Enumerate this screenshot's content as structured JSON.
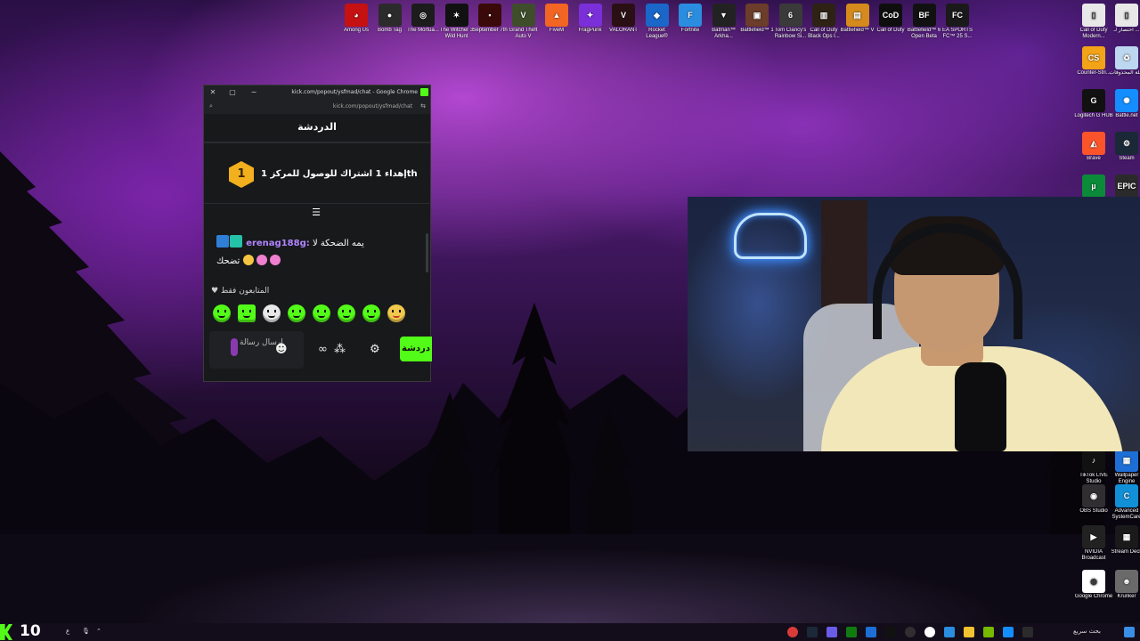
{
  "desktop": {
    "top_icons": [
      {
        "label": "Among Us",
        "color": "#c51111",
        "glyph": "◕"
      },
      {
        "label": "Bomb Tag",
        "color": "#2b2b2b",
        "glyph": "●"
      },
      {
        "label": "The Mortua...",
        "color": "#1c1c1c",
        "glyph": "◎"
      },
      {
        "label": "The Witcher 3 Wild Hunt",
        "color": "#111111",
        "glyph": "✶"
      },
      {
        "label": "September 7th",
        "color": "#3a0a0a",
        "glyph": "▪"
      },
      {
        "label": "Grand Theft Auto V",
        "color": "#3f4d2a",
        "glyph": "V"
      },
      {
        "label": "FiveM",
        "color": "#f26522",
        "glyph": "▲"
      },
      {
        "label": "FragPunk",
        "color": "#7a2fd8",
        "glyph": "✦"
      },
      {
        "label": "VALORANT",
        "color": "#2a1014",
        "glyph": "V"
      },
      {
        "label": "Rocket League®",
        "color": "#1b66c9",
        "glyph": "◆"
      },
      {
        "label": "Fortnite",
        "color": "#2a8de0",
        "glyph": "F"
      },
      {
        "label": "Batman™ Arkha...",
        "color": "#222222",
        "glyph": "▼"
      },
      {
        "label": "Battlefield™ 1",
        "color": "#6b3d2a",
        "glyph": "▣"
      },
      {
        "label": "Tom Clancy's Rainbow Si...",
        "color": "#3a3a3a",
        "glyph": "6"
      },
      {
        "label": "Call of Duty Black Ops I...",
        "color": "#2d2214",
        "glyph": "▥"
      },
      {
        "label": "Battlefield™ V",
        "color": "#d48a1c",
        "glyph": "▤"
      },
      {
        "label": "Call of Duty",
        "color": "#0e0e0e",
        "glyph": "CoD"
      },
      {
        "label": "Battlefield™ 6 Open Beta",
        "color": "#111111",
        "glyph": "BF"
      },
      {
        "label": "EA SPORTS FC™ 25 S...",
        "color": "#1a1a1a",
        "glyph": "FC"
      }
    ],
    "right_icons": [
      {
        "label": "Call of Duty Modern...",
        "color": "#e8e8e8",
        "glyph": "▯"
      },
      {
        "label": "اختصار لـ ...",
        "color": "#e8e8e8",
        "glyph": "▯"
      },
      {
        "label": "Counter-Stri...",
        "color": "#f2a317",
        "glyph": "CS"
      },
      {
        "label": "سلة المحذوفات",
        "color": "#bcd7ef",
        "glyph": "♻"
      },
      {
        "label": "Logitech G HUB",
        "color": "#111111",
        "glyph": "G"
      },
      {
        "label": "Battle.net",
        "color": "#148eff",
        "glyph": "✺"
      },
      {
        "label": "Brave",
        "color": "#fb542b",
        "glyph": "◭"
      },
      {
        "label": "Steam",
        "color": "#1b2838",
        "glyph": "⚙"
      },
      {
        "label": "uTorrent",
        "color": "#0b8a3a",
        "glyph": "µ"
      },
      {
        "label": "EPIC GAMES",
        "color": "#2a2a2a",
        "glyph": "EPIC"
      },
      {
        "label": "TikTok LIVE Studio",
        "color": "#111111",
        "glyph": "♪"
      },
      {
        "label": "Wallpaper Engine",
        "color": "#1d6fd6",
        "glyph": "▦"
      },
      {
        "label": "OBS Studio",
        "color": "#302e31",
        "glyph": "◉"
      },
      {
        "label": "Advanced SystemCare",
        "color": "#1190d8",
        "glyph": "C"
      },
      {
        "label": "NVIDIA Broadcast",
        "color": "#222222",
        "glyph": "▶"
      },
      {
        "label": "Stream Deck",
        "color": "#1a1a1a",
        "glyph": "▦"
      },
      {
        "label": "Google Chrome",
        "color": "#ffffff",
        "glyph": "◍"
      },
      {
        "label": "Krunker",
        "color": "#6a6a6a",
        "glyph": "☻"
      }
    ]
  },
  "window": {
    "title": "kick.com/popout/ysfmad/chat - Google Chrome",
    "url": "kick.com/popout/ysfmad/chat",
    "chat_header": "الدردشة",
    "goal_badge": "1",
    "goal_text": "إهداء 1 اشتراك للوصول للمركز 1th",
    "message": {
      "username": "erenag188g",
      "separator": ":",
      "text_line1": "يمه الضحكة لا",
      "text_line2": "تضحك"
    },
    "followers_only": "المتابعون فقط",
    "input_placeholder": "ارسال رسالة",
    "send_label": "دردشة",
    "brand_color": "#53fc18"
  },
  "taskbar": {
    "number": "10",
    "search_text": "بحث سريع"
  }
}
